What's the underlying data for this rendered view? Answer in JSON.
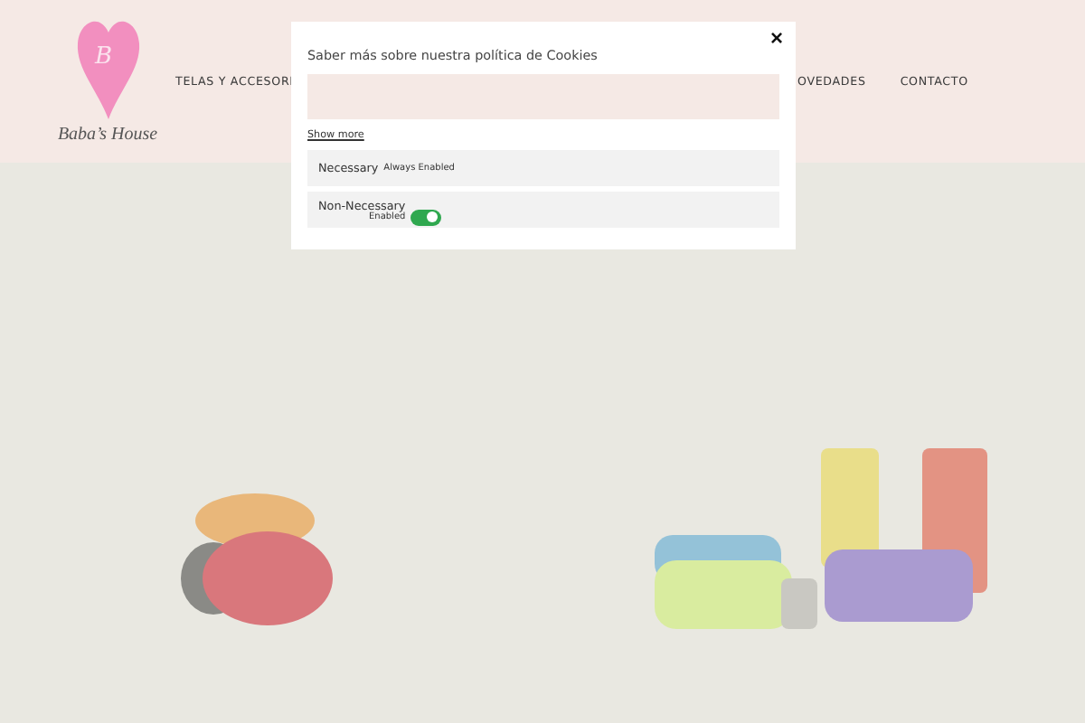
{
  "logo": {
    "initial": "B",
    "text": "Baba’s House"
  },
  "nav": [
    "TELAS Y ACCESORI",
    "OVEDADES",
    "CONTACTO"
  ],
  "cookie_modal": {
    "close": "×",
    "title": "Saber más sobre nuestra política de Cookies",
    "show_more": "Show more",
    "categories": [
      {
        "kind": "always",
        "name": "Necessary",
        "status": "Always Enabled"
      },
      {
        "kind": "toggle",
        "name": "Non-Necessary",
        "status": "Enabled",
        "on": true
      }
    ]
  }
}
